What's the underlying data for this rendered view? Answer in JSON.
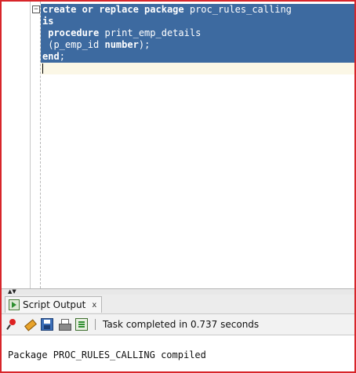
{
  "editor": {
    "lines": [
      [
        {
          "t": "create or replace package",
          "kw": true
        },
        {
          "t": " proc_rules_calling",
          "kw": false
        }
      ],
      [
        {
          "t": "is",
          "kw": true
        }
      ],
      [
        {
          "t": " procedure",
          "kw": true
        },
        {
          "t": " print_emp_details",
          "kw": false
        }
      ],
      [
        {
          "t": " (p_emp_id ",
          "kw": false
        },
        {
          "t": "number",
          "kw": true
        },
        {
          "t": ");",
          "kw": false
        }
      ],
      [
        {
          "t": "end",
          "kw": true
        },
        {
          "t": ";",
          "kw": false
        }
      ]
    ],
    "fold_symbol": "−"
  },
  "panel": {
    "tab_label": "Script Output",
    "tab_close": "x",
    "status": "Task completed in 0.737 seconds",
    "output": "Package PROC_RULES_CALLING compiled"
  },
  "splitter": {
    "arrows": "▲▼"
  },
  "colors": {
    "selection": "#3d6aa0",
    "frame": "#d8252a"
  }
}
